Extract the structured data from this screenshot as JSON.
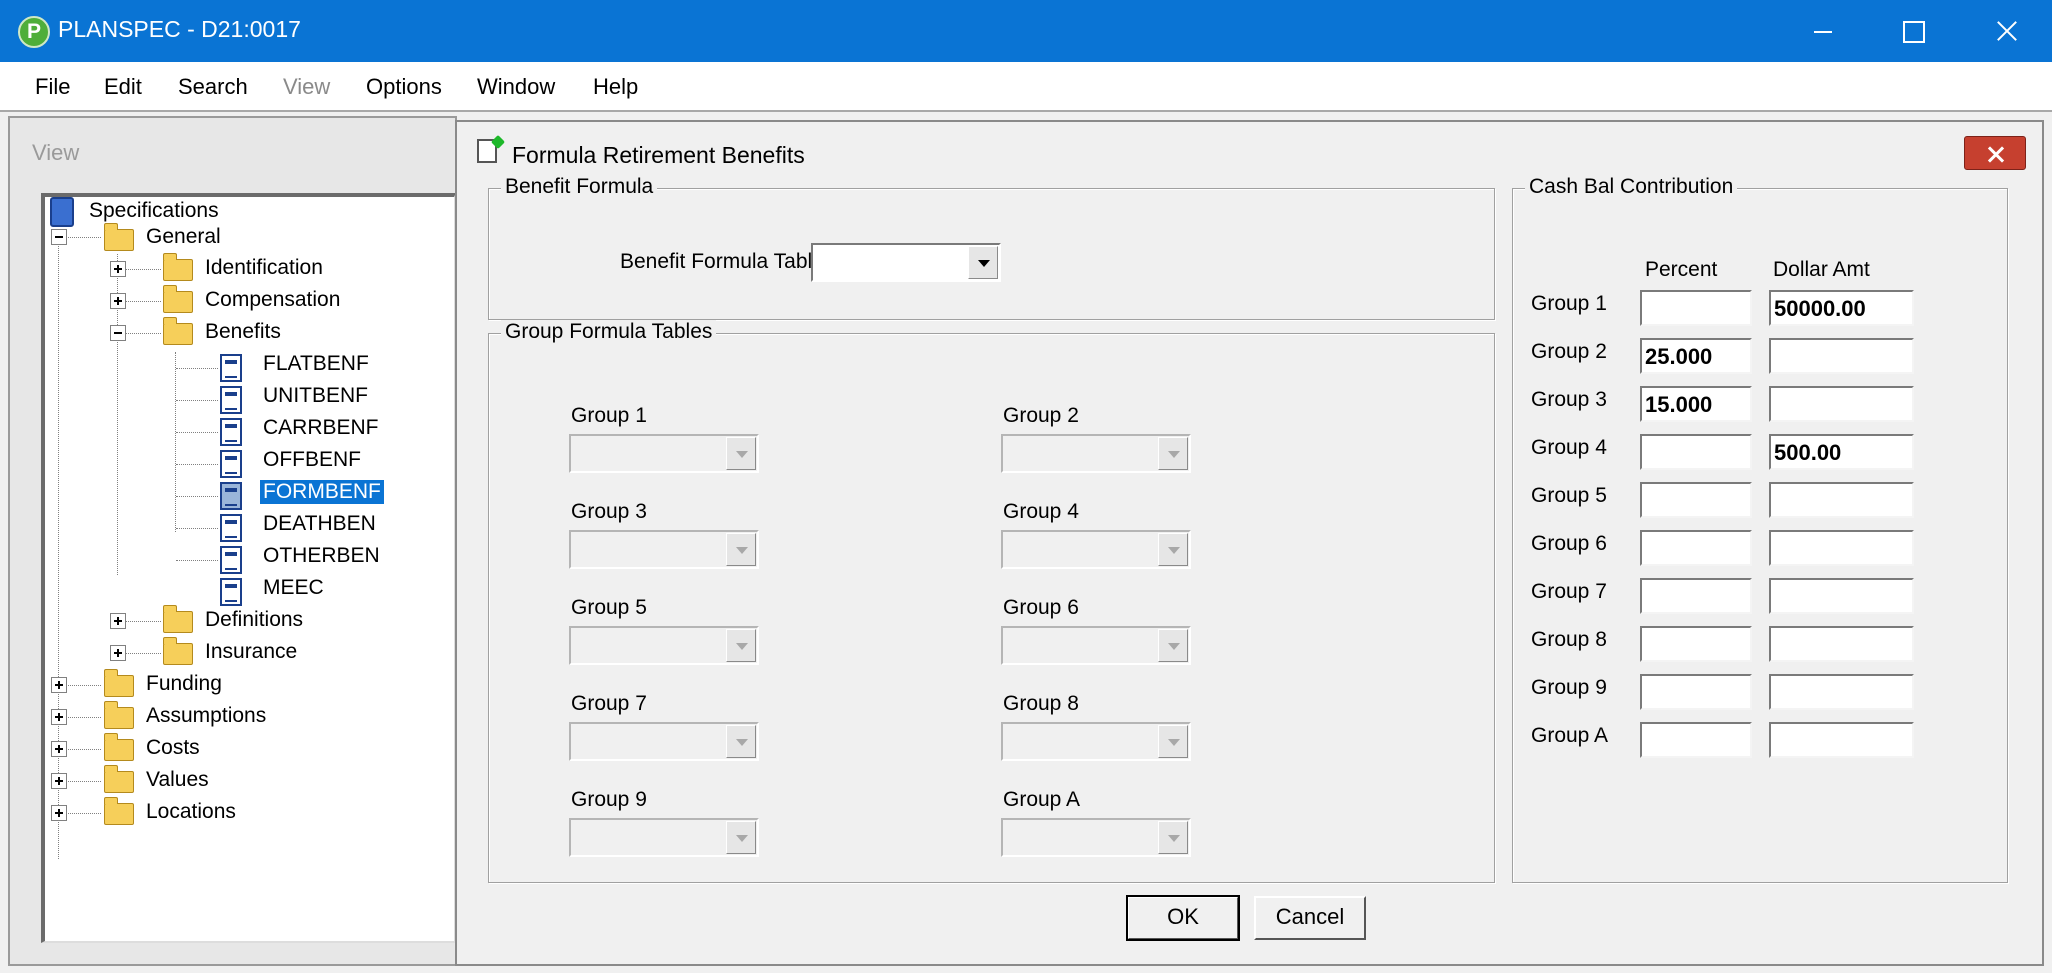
{
  "window": {
    "app_icon_letter": "P",
    "title": "PLANSPEC - D21:0017"
  },
  "menu": {
    "file": "File",
    "edit": "Edit",
    "search": "Search",
    "view": "View",
    "options": "Options",
    "window": "Window",
    "help": "Help"
  },
  "view_pane": {
    "title": "View",
    "tree": {
      "root": "Specifications",
      "general": "General",
      "identification": "Identification",
      "compensation": "Compensation",
      "benefits": "Benefits",
      "benefit_items": [
        "FLATBENF",
        "UNITBENF",
        "CARRBENF",
        "OFFBENF",
        "FORMBENF",
        "DEATHBEN",
        "OTHERBEN",
        "MEEC"
      ],
      "selected": "FORMBENF",
      "definitions": "Definitions",
      "insurance": "Insurance",
      "funding": "Funding",
      "assumptions": "Assumptions",
      "costs": "Costs",
      "values": "Values",
      "locations": "Locations"
    }
  },
  "dialog": {
    "title": "Formula Retirement Benefits",
    "benefit_formula": {
      "title": "Benefit Formula",
      "table_label": "Benefit Formula Table",
      "table_value": ""
    },
    "group_formula_tables": {
      "title": "Group Formula Tables",
      "groups": [
        "Group 1",
        "Group 2",
        "Group 3",
        "Group 4",
        "Group 5",
        "Group 6",
        "Group 7",
        "Group 8",
        "Group 9",
        "Group A"
      ]
    },
    "cash_bal": {
      "title": "Cash Bal Contribution",
      "col_percent": "Percent",
      "col_dollar": "Dollar Amt",
      "rows": [
        {
          "label": "Group 1",
          "percent": "",
          "dollar": "50000.00"
        },
        {
          "label": "Group 2",
          "percent": "25.000",
          "dollar": ""
        },
        {
          "label": "Group 3",
          "percent": "15.000",
          "dollar": ""
        },
        {
          "label": "Group 4",
          "percent": "",
          "dollar": "500.00"
        },
        {
          "label": "Group 5",
          "percent": "",
          "dollar": ""
        },
        {
          "label": "Group 6",
          "percent": "",
          "dollar": ""
        },
        {
          "label": "Group 7",
          "percent": "",
          "dollar": ""
        },
        {
          "label": "Group 8",
          "percent": "",
          "dollar": ""
        },
        {
          "label": "Group 9",
          "percent": "",
          "dollar": ""
        },
        {
          "label": "Group A",
          "percent": "",
          "dollar": ""
        }
      ]
    },
    "ok_label": "OK",
    "cancel_label": "Cancel"
  }
}
